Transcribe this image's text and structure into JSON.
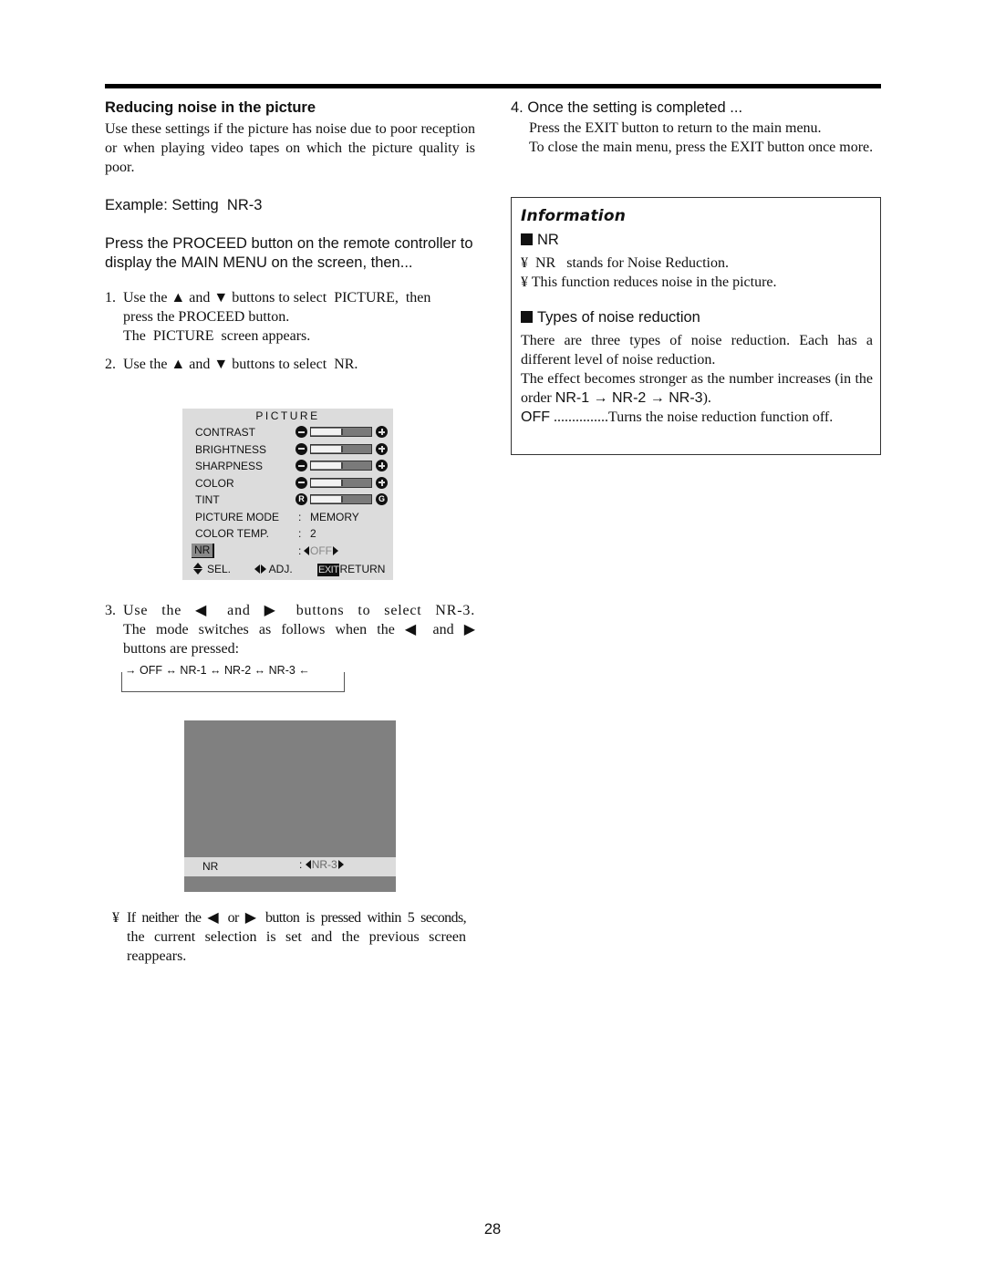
{
  "page_number": "28",
  "left_column": {
    "section_title": "Reducing noise in the picture",
    "intro": "Use these settings if the picture has noise due to poor reception or when playing video tapes on which the picture quality is poor.",
    "example": "Example: Setting  NR-3",
    "press_instruction": "Press the PROCEED button on the remote controller to display the MAIN MENU on the screen, then...",
    "steps": [
      {
        "number": "1.",
        "lines": [
          "Use the ▲ and ▼ buttons to select  PICTURE,  then",
          "press the PROCEED button.",
          "The  PICTURE  screen appears."
        ]
      },
      {
        "number": "2.",
        "lines": [
          "Use the ▲ and ▼ buttons to select  NR."
        ]
      },
      {
        "number": "3.",
        "lines": [
          "Use the ◀  and  ▶ buttons to select  NR-3.",
          "The mode switches as follows when the ◀ and ▶",
          "buttons are pressed:"
        ]
      }
    ],
    "cycle_diagram": "→ OFF ↔ NR-1 ↔ NR-2 ↔ NR-3 ←",
    "note": {
      "bullet": "¥",
      "lines": [
        "If neither the ◀ or ▶ button is pressed within 5 seconds,",
        "the current selection is set and the previous screen",
        "reappears."
      ]
    }
  },
  "osd_picture_menu": {
    "title": "PICTURE",
    "sliders": [
      {
        "label": "CONTRAST",
        "left_icon": "minus-icon",
        "right_icon": "plus-icon",
        "level": 0.5
      },
      {
        "label": "BRIGHTNESS",
        "left_icon": "minus-icon",
        "right_icon": "plus-icon",
        "level": 0.5
      },
      {
        "label": "SHARPNESS",
        "left_icon": "minus-icon",
        "right_icon": "plus-icon",
        "level": 0.5
      },
      {
        "label": "COLOR",
        "left_icon": "minus-icon",
        "right_icon": "plus-icon",
        "level": 0.5
      },
      {
        "label": "TINT",
        "left_icon": "R",
        "right_icon": "G",
        "level": 0.5
      }
    ],
    "settings": [
      {
        "label": "PICTURE MODE",
        "colon": ":",
        "value": "MEMORY"
      },
      {
        "label": "COLOR TEMP.",
        "colon": ":",
        "value": "2"
      }
    ],
    "nr_row": {
      "label": "NR",
      "colon": ":",
      "value": "OFF"
    },
    "footer": {
      "sel_label": "SEL.",
      "adj_label": "ADJ.",
      "exit_key": "EXIT",
      "return_label": "RETURN"
    }
  },
  "osd_nr_screen": {
    "label": "NR",
    "colon": ":",
    "value": "NR-3"
  },
  "right_column": {
    "step4": {
      "number": "4.",
      "title": "Once the setting is completed ...",
      "lines": [
        "Press the EXIT button to return to the main menu.",
        "To close the main menu, press the EXIT button once more."
      ]
    },
    "information": {
      "title": "Information",
      "nr_heading": "NR",
      "nr_bullets": [
        "¥  NR   stands for Noise Reduction.",
        "¥ This function reduces noise in the picture."
      ],
      "types_heading": "Types of noise reduction",
      "types_paragraph_1": "There are three types of noise reduction. Each has a different level of noise reduction.",
      "types_paragraph_2_prefix": "The effect becomes stronger as the number increases (in the order ",
      "types_order": "NR-1 → NR-2 → NR-3",
      "types_paragraph_2_suffix": ").",
      "off_term": "OFF",
      "off_dots": "...............",
      "off_description": "Turns the noise reduction function off."
    }
  }
}
